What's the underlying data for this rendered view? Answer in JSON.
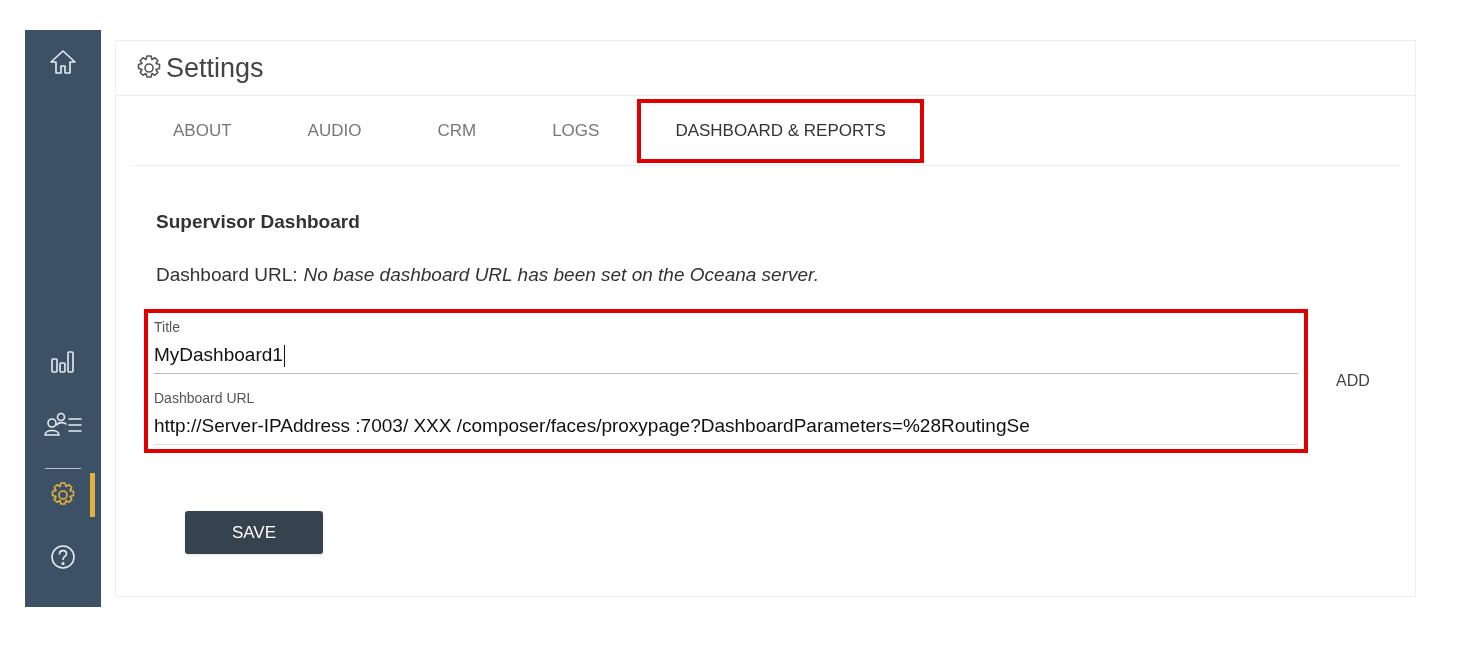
{
  "sidebar": {
    "items": [
      {
        "kind": "home",
        "selected": false
      },
      {
        "kind": "chart",
        "selected": false
      },
      {
        "kind": "agents",
        "selected": false
      },
      {
        "kind": "settings",
        "selected": true
      },
      {
        "kind": "help",
        "selected": false
      }
    ]
  },
  "header": {
    "title": "Settings"
  },
  "tabs": [
    {
      "label": "ABOUT",
      "selected": false,
      "highlighted": false
    },
    {
      "label": "AUDIO",
      "selected": false,
      "highlighted": false
    },
    {
      "label": "CRM",
      "selected": false,
      "highlighted": false
    },
    {
      "label": "LOGS",
      "selected": false,
      "highlighted": false
    },
    {
      "label": "DASHBOARD & REPORTS",
      "selected": true,
      "highlighted": true
    }
  ],
  "section": {
    "title": "Supervisor Dashboard",
    "url_label": "Dashboard URL:",
    "url_note": "No base dashboard URL has been set on the Oceana server."
  },
  "form": {
    "highlighted": true,
    "fields": [
      {
        "label": "Title",
        "value": "MyDashboard1",
        "focused": true
      },
      {
        "label": "Dashboard URL",
        "value": "http://Server-IPAddress :7003/ XXX /composer/faces/proxypage?DashboardParameters=%28RoutingSe",
        "focused": false
      }
    ],
    "add_button": "ADD"
  },
  "save_button": "SAVE"
}
